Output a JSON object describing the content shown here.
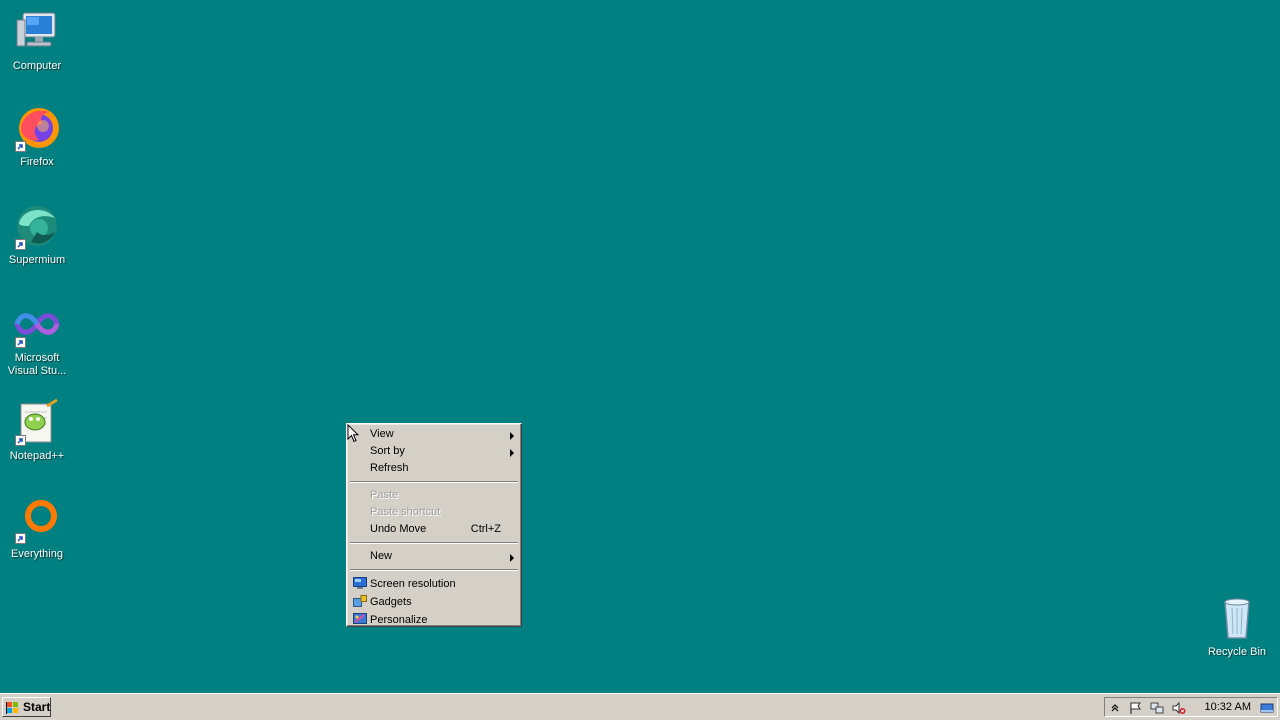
{
  "desktop": {
    "background": "#008080",
    "icons": [
      {
        "label": "Computer"
      },
      {
        "label": "Firefox"
      },
      {
        "label": "Supermium"
      },
      {
        "label": "Microsoft Visual Stu..."
      },
      {
        "label": "Notepad++"
      },
      {
        "label": "Everything"
      },
      {
        "label": "Recycle Bin"
      }
    ]
  },
  "context_menu": {
    "items": [
      {
        "label": "View",
        "submenu": true,
        "enabled": true
      },
      {
        "label": "Sort by",
        "submenu": true,
        "enabled": true
      },
      {
        "label": "Refresh",
        "enabled": true
      },
      {
        "label": "Paste",
        "enabled": false
      },
      {
        "label": "Paste shortcut",
        "enabled": false
      },
      {
        "label": "Undo Move",
        "shortcut": "Ctrl+Z",
        "enabled": true
      },
      {
        "label": "New",
        "submenu": true,
        "enabled": true
      },
      {
        "label": "Screen resolution",
        "icon": "display-icon",
        "enabled": true
      },
      {
        "label": "Gadgets",
        "icon": "gadgets-icon",
        "enabled": true
      },
      {
        "label": "Personalize",
        "icon": "personalize-icon",
        "enabled": true
      }
    ]
  },
  "taskbar": {
    "start_label": "Start",
    "tray_icons": [
      "chevron-up-icon",
      "action-center-flag-icon",
      "network-icon",
      "volume-muted-icon",
      "show-desktop-icon"
    ],
    "clock": "10:32 AM"
  }
}
